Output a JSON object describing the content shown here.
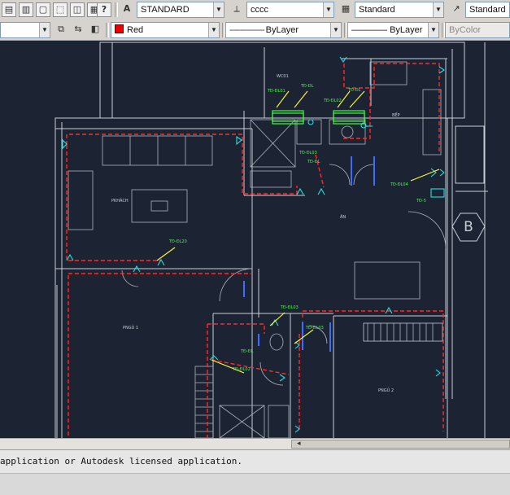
{
  "toolbar1": {
    "icons": [
      "layer-props-icon",
      "layer-states-icon",
      "layer-prev-icon",
      "layer-iso-icon",
      "layer-match-icon",
      "layer-freeze-icon",
      "help-icon"
    ],
    "help_glyph": "?",
    "text_style": "STANDARD",
    "dim_style": "cccc",
    "table_style": "Standard",
    "mleader_style": "Standard"
  },
  "toolbar2": {
    "color": "Red",
    "linetype": "ByLayer",
    "lineweight": "ByLayer",
    "plotstyle": "ByColor"
  },
  "rooms": {
    "p_khach": "PKHÁCH",
    "an": "ĂN",
    "bep": "BẾP",
    "wc1": "WC01",
    "p_ngu1": "PNGỦ 1",
    "p_ngu2": "PNGỦ 2"
  },
  "tags": {
    "t1": "TĐ-ĐL01",
    "t2": "TĐ-ĐL",
    "t3": "TĐ-ĐL02",
    "t4": "TĐ-ĐL",
    "t5": "TĐ-ĐL03",
    "t6": "TĐ-ĐL04",
    "t7": "TĐ-ĐL20",
    "t8": "TĐ-ĐL03",
    "t9": "TĐ-ĐL03",
    "t10": "TĐ-ĐL02",
    "t11": "TĐ-ĐL",
    "t12": "TĐ-ĐL",
    "t13": "TĐ-5"
  },
  "grid_marker": "B",
  "command_line": {
    "history": "application or Autodesk licensed application."
  },
  "colors": {
    "canvas": "#1c2333",
    "walls": "#c9ced6",
    "circuit": "#ff2a2a",
    "device": "#20e3e3",
    "tag": "#3cff3c",
    "arrow": "#ffff33"
  }
}
